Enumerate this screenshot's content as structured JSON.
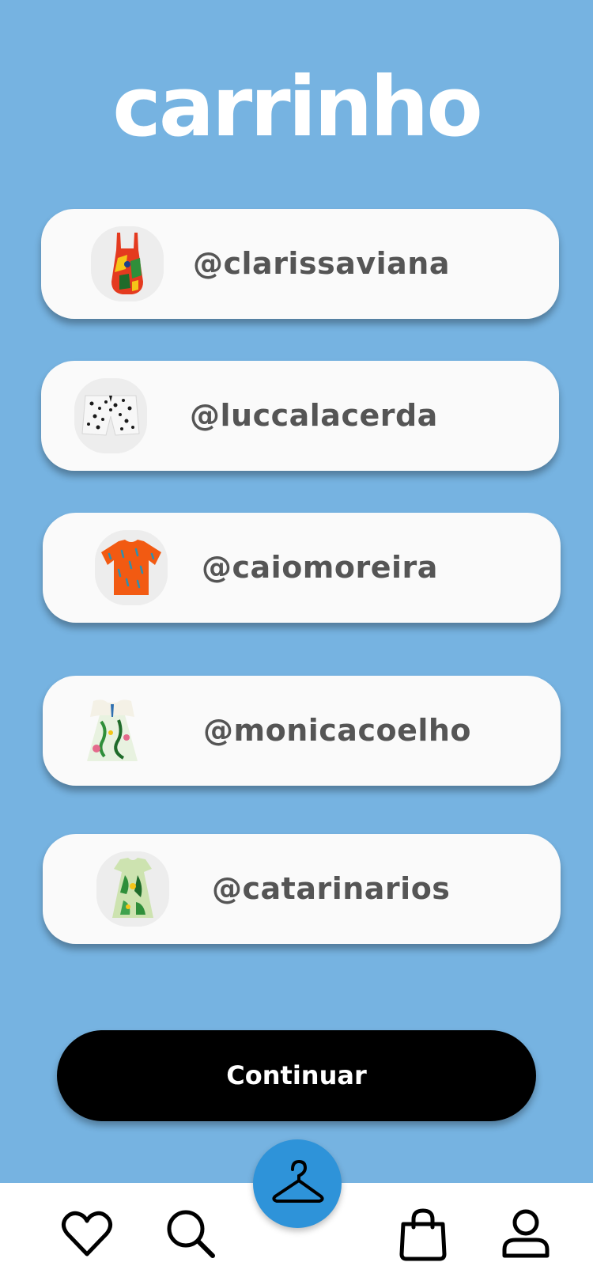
{
  "header": {
    "title": "carrinho"
  },
  "cart": {
    "items": [
      {
        "seller": "@clarissaviana",
        "thumbnail_icon": "overall-dress-icon"
      },
      {
        "seller": "@luccalacerda",
        "thumbnail_icon": "shorts-icon"
      },
      {
        "seller": "@caiomoreira",
        "thumbnail_icon": "tshirt-icon"
      },
      {
        "seller": "@monicacoelho",
        "thumbnail_icon": "floral-dress-icon"
      },
      {
        "seller": "@catarinarios",
        "thumbnail_icon": "leaf-dress-icon"
      }
    ]
  },
  "actions": {
    "continue_label": "Continuar"
  },
  "bottom_nav": {
    "items": [
      {
        "icon": "heart-icon"
      },
      {
        "icon": "search-icon"
      },
      {
        "icon": "hanger-icon",
        "active": true
      },
      {
        "icon": "bag-icon"
      },
      {
        "icon": "profile-icon"
      }
    ]
  },
  "colors": {
    "background": "#76B3E1",
    "card": "#FAFAFA",
    "seller_text": "#555555",
    "button": "#000000",
    "fab": "#2E93D9"
  }
}
